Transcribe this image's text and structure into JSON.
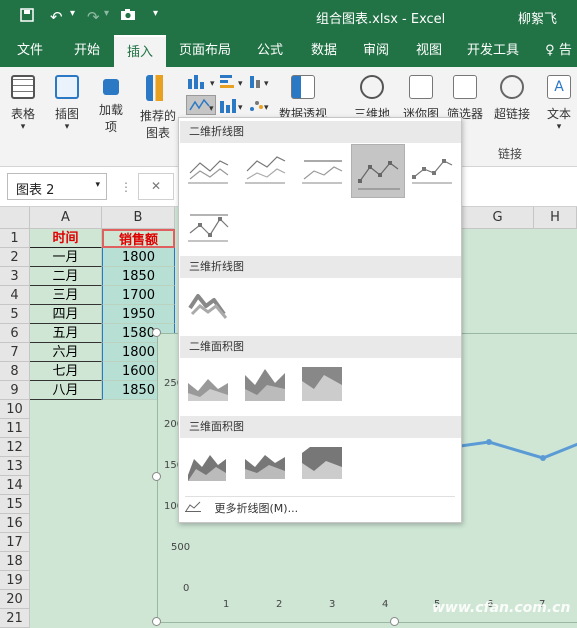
{
  "app": {
    "title": "组合图表.xlsx  -  Excel",
    "user": "柳絮飞"
  },
  "qat": {
    "save": "save-icon",
    "undo": "undo-icon",
    "redo": "redo-icon",
    "camera": "camera-icon",
    "more": "customize-icon"
  },
  "tabs": [
    "文件",
    "开始",
    "插入",
    "页面布局",
    "公式",
    "数据",
    "审阅",
    "视图",
    "开发工具",
    "告"
  ],
  "active_tab": "插入",
  "ribbon": {
    "table": "表格",
    "illustrations": "插图",
    "addins_line1": "加载",
    "addins_line2": "项",
    "recommended_line1": "推荐的",
    "recommended_line2": "图表",
    "pivot": "数据透视图",
    "map": "三维地",
    "sparkline": "迷你图",
    "filter": "筛选器",
    "hyperlink": "超链接",
    "text": "文本",
    "links_group": "链接"
  },
  "namebox": "图表 2",
  "formula_cancel": "✕",
  "columns": [
    "A",
    "B",
    "G",
    "H"
  ],
  "rows": [
    "1",
    "2",
    "3",
    "4",
    "5",
    "6",
    "7",
    "8",
    "9",
    "10",
    "11",
    "12",
    "13",
    "14",
    "15",
    "16",
    "17",
    "18",
    "19",
    "20",
    "21"
  ],
  "table": {
    "headers": [
      "时间",
      "销售额"
    ],
    "months": [
      "一月",
      "二月",
      "三月",
      "四月",
      "五月",
      "六月",
      "七月",
      "八月"
    ],
    "sales": [
      "1800",
      "1850",
      "1700",
      "1950",
      "1580",
      "1800",
      "1600",
      "1850"
    ]
  },
  "chart": {
    "yticks": [
      "250",
      "200",
      "150",
      "100",
      "500",
      "0"
    ],
    "xticks": [
      "1",
      "2",
      "3",
      "4",
      "5",
      "6",
      "7"
    ]
  },
  "dropdown": {
    "section_2d_line": "二维折线图",
    "section_3d_line": "三维折线图",
    "section_2d_area": "二维面积图",
    "section_3d_area": "三维面积图",
    "more": "更多折线图(M)..."
  },
  "watermark": "www.cfan.com.cn"
}
